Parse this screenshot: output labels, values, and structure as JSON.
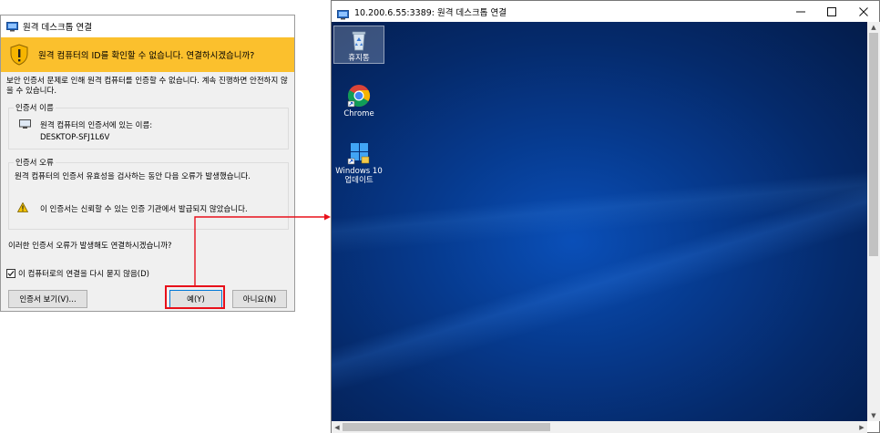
{
  "dialog": {
    "title": "원격 데스크톱 연결",
    "banner": "원격 컴퓨터의 ID를 확인할 수 없습니다. 연결하시겠습니까?",
    "description": "보안 인증서 문제로 인해 원격 컴퓨터를 인증할 수 없습니다. 계속 진행하면 안전하지 않을 수 있습니다.",
    "cert_group": {
      "legend": "인증서 이름",
      "label": "원격 컴퓨터의 인증서에 있는 이름:",
      "name": "DESKTOP-SFJ1L6V"
    },
    "error_group": {
      "legend": "인증서 오류",
      "description": "원격 컴퓨터의 인증서 유효성을 검사하는 동안 다음 오류가 발생했습니다.",
      "error": "이 인증서는 신뢰할 수 있는 인증 기관에서 발급되지 않았습니다."
    },
    "question": "이러한 인증서 오류가 발생해도 연결하시겠습니까?",
    "checkbox_label": "이 컴퓨터로의 연결을 다시 묻지 않음(D)",
    "checkbox_checked": true,
    "buttons": {
      "view_cert": "인증서 보기(V)...",
      "yes": "예(Y)",
      "no": "아니요(N)"
    }
  },
  "rdp_window": {
    "title": "10.200.6.55:3389: 원격 데스크톱 연결",
    "desktop_icons": [
      {
        "label": "휴지통",
        "icon": "recycle-bin-icon"
      },
      {
        "label": "Chrome",
        "icon": "chrome-icon"
      },
      {
        "label": "Windows 10 업데이트",
        "icon": "windows-update-icon"
      }
    ]
  },
  "colors": {
    "banner": "#fbc02d",
    "highlight": "#e8101a",
    "desktop": "#063a8e",
    "accent": "#0078d7"
  }
}
